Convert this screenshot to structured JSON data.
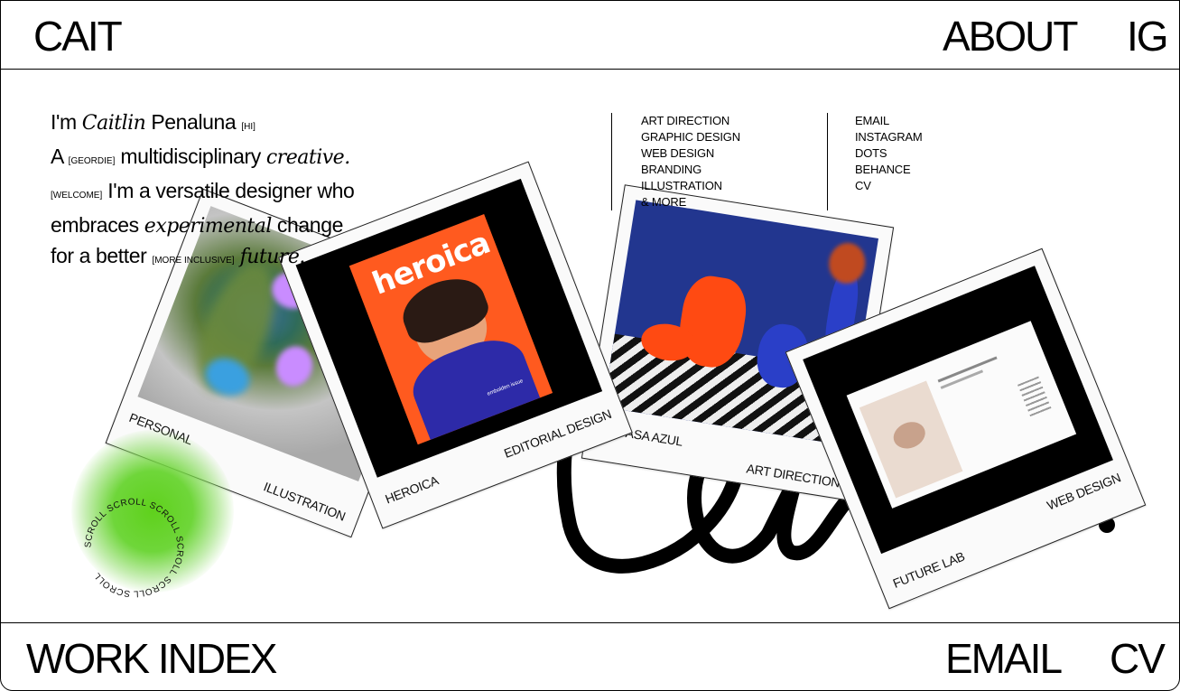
{
  "header": {
    "brand": "CAIT",
    "nav": [
      "ABOUT",
      "IG"
    ]
  },
  "footer": {
    "left": "WORK INDEX",
    "right": [
      "EMAIL",
      "CV"
    ]
  },
  "intro": {
    "im": "I'm",
    "first_name": "Caitlin",
    "last_name": "Penaluna",
    "tag_hi": "[HI]",
    "a": "A",
    "tag_geordie": "[GEORDIE]",
    "multidisciplinary": "multidisciplinary",
    "creative": "creative.",
    "tag_welcome": "[WELCOME]",
    "versatile": "I'm a versatile designer who",
    "embraces": "embraces",
    "experimental": "experimental",
    "change": "change",
    "for_a_better": "for a better",
    "tag_more_inclusive": "[MORE INCLUSIVE]",
    "future": "future."
  },
  "services": [
    "ART DIRECTION",
    "GRAPHIC DESIGN",
    "WEB DESIGN",
    "BRANDING",
    "ILLUSTRATION",
    "& MORE"
  ],
  "links": [
    "EMAIL",
    "INSTAGRAM",
    "DOTS",
    "BEHANCE",
    "CV"
  ],
  "cards": [
    {
      "title": "PERSONAL",
      "category": "ILLUSTRATION"
    },
    {
      "title": "HEROICA",
      "category": "EDITORIAL DESIGN",
      "cover_title": "heroica",
      "cover_caption": "embolden issue"
    },
    {
      "title": "LA CASA AZUL",
      "category": "ART DIRECTION"
    },
    {
      "title": "FUTURE LAB",
      "category": "WEB DESIGN"
    }
  ],
  "scroll": {
    "word": "SCROLL",
    "repeat": "SCROLL SCROLL SCROLL SCROLL SCROLL SCROLL "
  },
  "colors": {
    "glow": "#5fd11c",
    "heroica_orange": "#ff5a1f",
    "casa_blue": "#22368f"
  }
}
